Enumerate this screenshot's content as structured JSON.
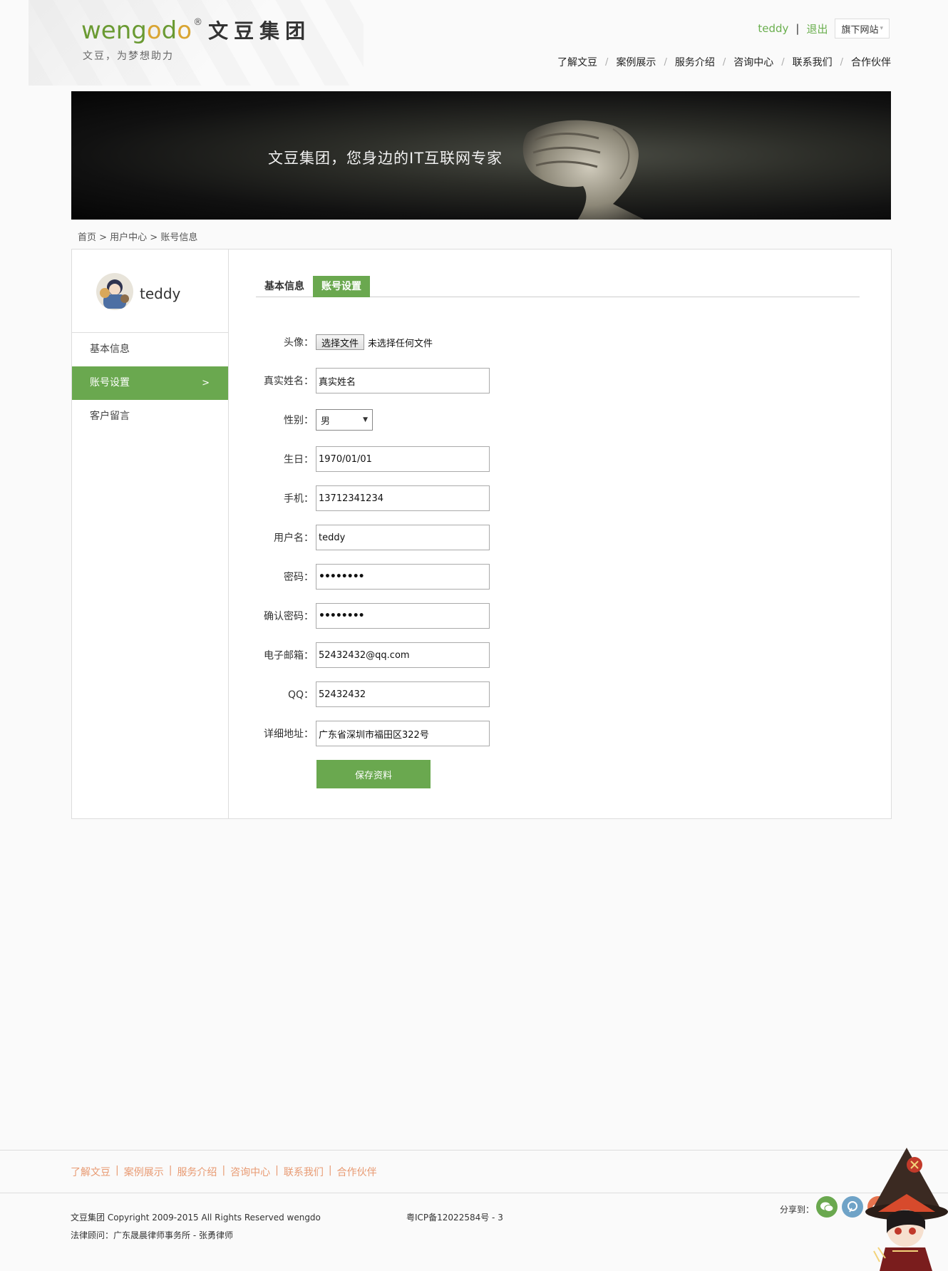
{
  "header": {
    "logo_en_pre": "weng",
    "logo_en_o": "o",
    "logo_en_mid": "d",
    "logo_en_o2": "o",
    "logo_reg": "®",
    "logo_cn": "文豆集团",
    "slogan": "文豆，为梦想助力",
    "user_name": "teddy",
    "user_sep": "|",
    "logout": "退出",
    "sites": "旗下网站",
    "nav": [
      "了解文豆",
      "案例展示",
      "服务介绍",
      "咨询中心",
      "联系我们",
      "合作伙伴"
    ],
    "nav_sep": "/"
  },
  "banner": {
    "text": "文豆集团，您身边的IT互联网专家"
  },
  "breadcrumb": "首页 > 用户中心 > 账号信息",
  "sidebar": {
    "user_name": "teddy",
    "items": [
      {
        "label": "基本信息",
        "active": false
      },
      {
        "label": "账号设置",
        "active": true,
        "arrow": ">"
      },
      {
        "label": "客户留言",
        "active": false
      }
    ]
  },
  "tabs": [
    {
      "label": "基本信息",
      "active": false
    },
    {
      "label": "账号设置",
      "active": true
    }
  ],
  "form": {
    "avatar_label": "头像：",
    "file_button": "选择文件",
    "file_status": "未选择任何文件",
    "realname_label": "真实姓名：",
    "realname_value": "真实姓名",
    "gender_label": "性别：",
    "gender_value": "男",
    "birthday_label": "生日：",
    "birthday_value": "1970/01/01",
    "phone_label": "手机：",
    "phone_value": "13712341234",
    "username_label": "用户名：",
    "username_value": "teddy",
    "password_label": "密码：",
    "password_value": "••••••••",
    "confirm_label": "确认密码：",
    "confirm_value": "••••••••",
    "email_label": "电子邮箱：",
    "email_value": "52432432@qq.com",
    "qq_label": "QQ：",
    "qq_value": "52432432",
    "address_label": "详细地址：",
    "address_value": "广东省深圳市福田区322号",
    "save_button": "保存资料"
  },
  "footer": {
    "links": [
      "了解文豆",
      "案例展示",
      "服务介绍",
      "咨询中心",
      "联系我们",
      "合作伙伴"
    ],
    "link_sep": "|",
    "copyright": "文豆集团 Copyright 2009-2015 All Rights Reserved wengdo",
    "icp": "粤ICP备12022584号 - 3",
    "lawyer": "法律顾问：广东晟晨律师事务所 - 张勇律师",
    "share_label": "分享到："
  },
  "colors": {
    "accent_green": "#6aa84f",
    "logo_green": "#6a9a32",
    "footer_link": "#e89a72"
  }
}
